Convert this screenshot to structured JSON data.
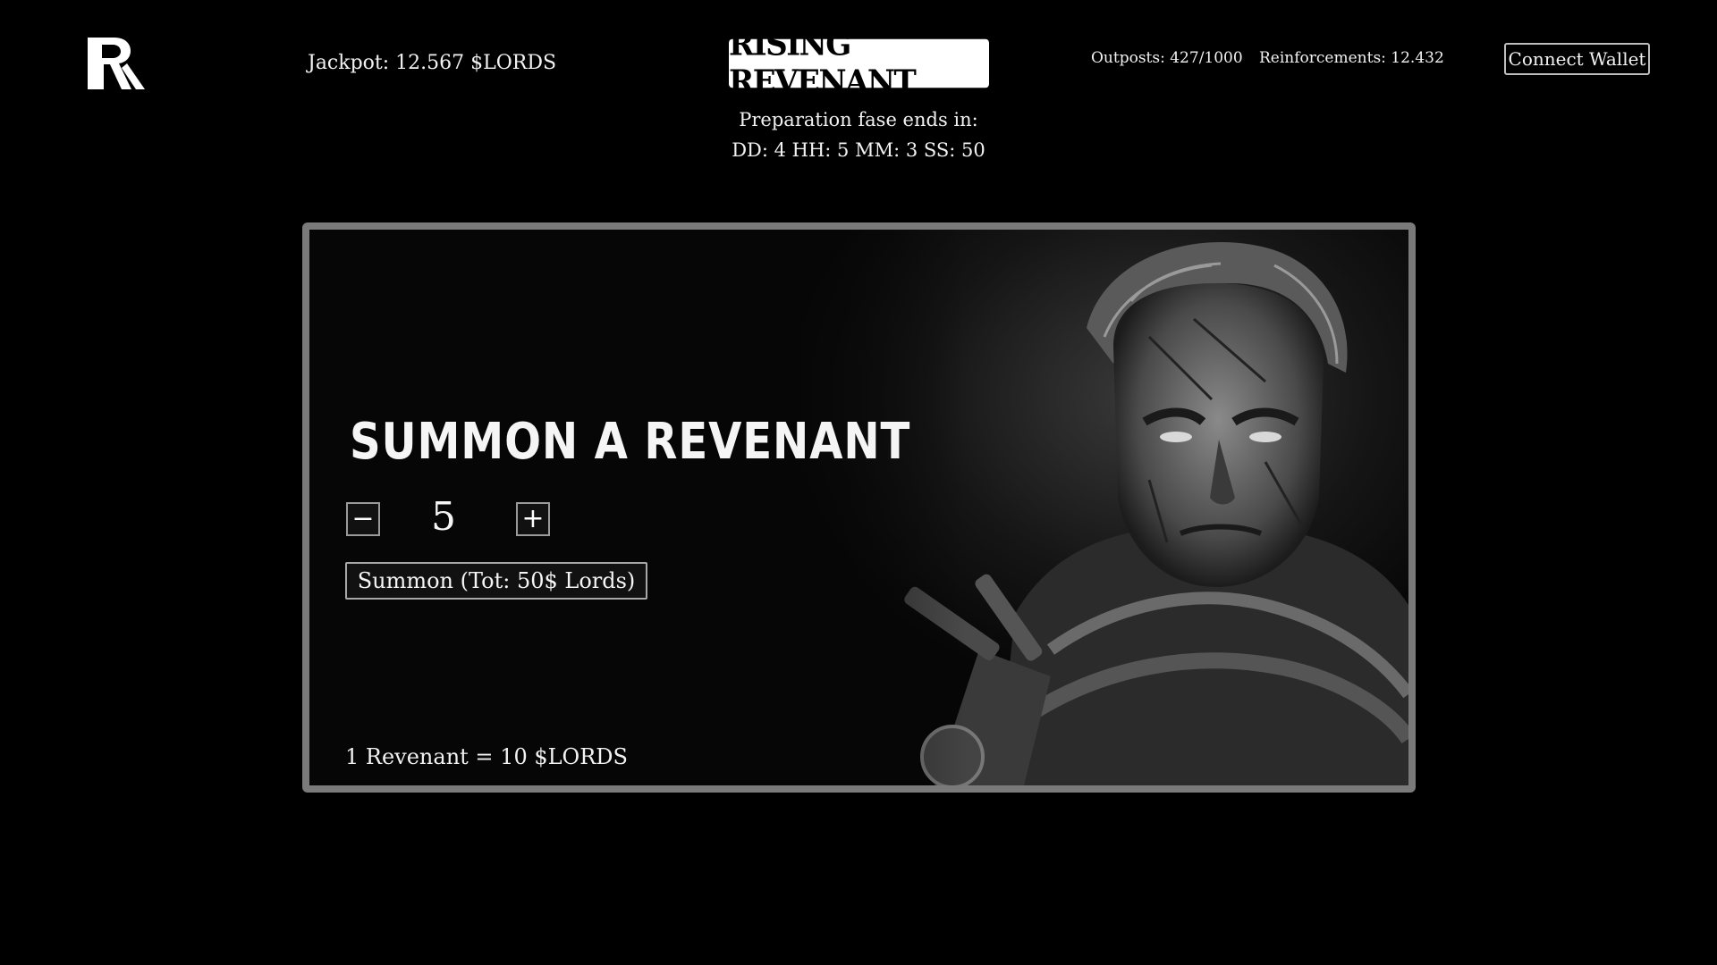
{
  "header": {
    "jackpot": "Jackpot: 12.567 $LORDS",
    "title": "RISING REVENANT",
    "countdown_label": "Preparation fase ends in:",
    "countdown_value": "DD: 4 HH: 5 MM: 3 SS: 50",
    "outposts": "Outposts: 427/1000",
    "reinforcements": "Reinforcements: 12.432",
    "connect_label": "Connect Wallet"
  },
  "summon": {
    "title": "SUMMON A REVENANT",
    "minus_label": "−",
    "plus_label": "+",
    "quantity": "5",
    "button_label": "Summon (Tot: 50$ Lords)",
    "price_note": "1 Revenant = 10 $LORDS"
  },
  "icons": {
    "logo": "rr-logo-icon",
    "art": "revenant-portrait"
  }
}
